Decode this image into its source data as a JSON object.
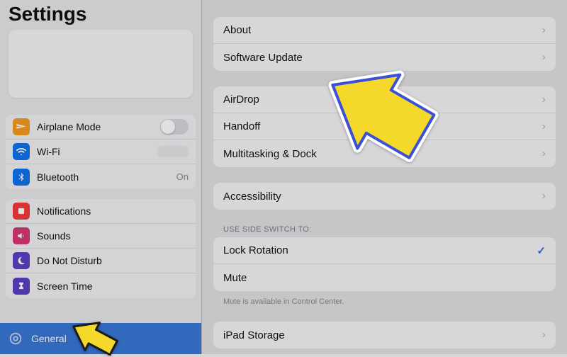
{
  "sidebar": {
    "title": "Settings",
    "items": [
      {
        "label": "Airplane Mode",
        "accessory": "toggle-off"
      },
      {
        "label": "Wi-Fi",
        "accessory": "wifi-value"
      },
      {
        "label": "Bluetooth",
        "accessory_text": "On"
      }
    ],
    "group2": [
      {
        "label": "Notifications"
      },
      {
        "label": "Sounds"
      },
      {
        "label": "Do Not Disturb"
      },
      {
        "label": "Screen Time"
      }
    ],
    "selected": {
      "label": "General"
    }
  },
  "detail": {
    "group1": [
      {
        "label": "About"
      },
      {
        "label": "Software Update"
      }
    ],
    "group2": [
      {
        "label": "AirDrop"
      },
      {
        "label": "Handoff"
      },
      {
        "label": "Multitasking & Dock"
      }
    ],
    "group3": [
      {
        "label": "Accessibility"
      }
    ],
    "sideSwitch": {
      "header": "USE SIDE SWITCH TO:",
      "items": [
        {
          "label": "Lock Rotation",
          "checked": true
        },
        {
          "label": "Mute",
          "checked": false
        }
      ],
      "footer": "Mute is available in Control Center."
    },
    "group5": [
      {
        "label": "iPad Storage"
      }
    ]
  },
  "colors": {
    "selection": "#3a78d8",
    "arrow_fill": "#f4d92a",
    "arrow_stroke_inner": "#3b4fd8",
    "arrow_stroke_outer": "#ffffff"
  }
}
